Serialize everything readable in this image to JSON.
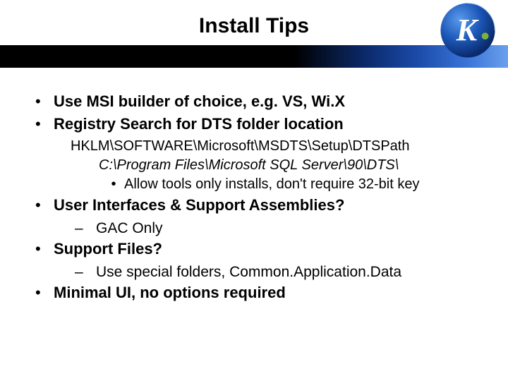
{
  "title": "Install Tips",
  "bullets": {
    "b1": "Use MSI builder of choice, e.g. VS, Wi.X",
    "b2": "Registry Search for DTS folder location",
    "b2_sub1": "HKLM\\SOFTWARE\\Microsoft\\MSDTS\\Setup\\DTSPath",
    "b2_sub2": "C:\\Program Files\\Microsoft SQL Server\\90\\DTS\\",
    "b2_sub3": "Allow tools only installs, don't require 32-bit key",
    "b3": "User Interfaces & Support Assemblies?",
    "b3_sub1": "GAC Only",
    "b4": "Support Files?",
    "b4_sub1": "Use special folders, Common.Application.Data",
    "b5": "Minimal UI, no options required"
  }
}
